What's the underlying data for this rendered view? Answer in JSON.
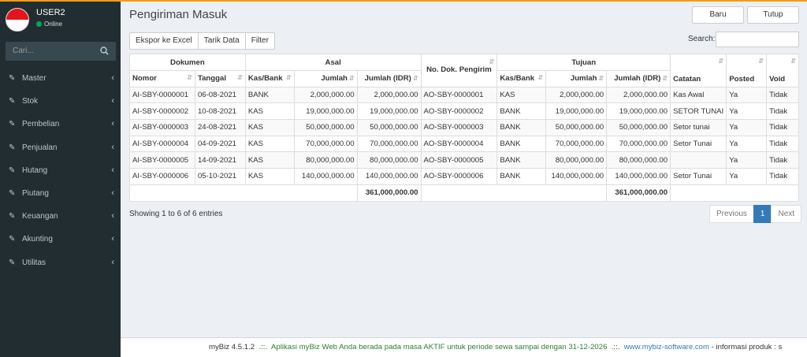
{
  "user": {
    "name": "USER2",
    "status": "Online"
  },
  "sidebar": {
    "search_placeholder": "Cari...",
    "items": [
      {
        "label": "Master"
      },
      {
        "label": "Stok"
      },
      {
        "label": "Pembelian"
      },
      {
        "label": "Penjualan"
      },
      {
        "label": "Hutang"
      },
      {
        "label": "Piutang"
      },
      {
        "label": "Keuangan"
      },
      {
        "label": "Akunting"
      },
      {
        "label": "Utilitas"
      }
    ]
  },
  "page": {
    "title": "Pengiriman Masuk",
    "new_label": "Baru",
    "close_label": "Tutup"
  },
  "toolbar": {
    "export_label": "Ekspor ke Excel",
    "fetch_label": "Tarik Data",
    "filter_label": "Filter"
  },
  "search": {
    "label": "Search:",
    "value": ""
  },
  "table": {
    "groups": {
      "dokumen": "Dokumen",
      "asal": "Asal",
      "nodok": "No. Dok. Pengirim",
      "tujuan": "Tujuan",
      "catatan": "Catatan",
      "posted": "Posted",
      "void": "Void"
    },
    "columns": [
      "Nomor",
      "Tanggal",
      "Kas/Bank",
      "Jumlah",
      "Jumlah (IDR)",
      "Kas/Bank",
      "Jumlah",
      "Jumlah (IDR)"
    ],
    "rows": [
      {
        "nomor": "AI-SBY-0000001",
        "tanggal": "06-08-2021",
        "kasbank": "BANK",
        "jumlah": "2,000,000.00",
        "jumlah_idr": "2,000,000.00",
        "nodok": "AO-SBY-0000001",
        "t_kasbank": "KAS",
        "t_jumlah": "2,000,000.00",
        "t_jumlah_idr": "2,000,000.00",
        "catatan": "Kas Awal",
        "posted": "Ya",
        "void": "Tidak"
      },
      {
        "nomor": "AI-SBY-0000002",
        "tanggal": "10-08-2021",
        "kasbank": "KAS",
        "jumlah": "19,000,000.00",
        "jumlah_idr": "19,000,000.00",
        "nodok": "AO-SBY-0000002",
        "t_kasbank": "BANK",
        "t_jumlah": "19,000,000.00",
        "t_jumlah_idr": "19,000,000.00",
        "catatan": "SETOR TUNAI",
        "posted": "Ya",
        "void": "Tidak"
      },
      {
        "nomor": "AI-SBY-0000003",
        "tanggal": "24-08-2021",
        "kasbank": "KAS",
        "jumlah": "50,000,000.00",
        "jumlah_idr": "50,000,000.00",
        "nodok": "AO-SBY-0000003",
        "t_kasbank": "BANK",
        "t_jumlah": "50,000,000.00",
        "t_jumlah_idr": "50,000,000.00",
        "catatan": "Setor tunai",
        "posted": "Ya",
        "void": "Tidak"
      },
      {
        "nomor": "AI-SBY-0000004",
        "tanggal": "04-09-2021",
        "kasbank": "KAS",
        "jumlah": "70,000,000.00",
        "jumlah_idr": "70,000,000.00",
        "nodok": "AO-SBY-0000004",
        "t_kasbank": "BANK",
        "t_jumlah": "70,000,000.00",
        "t_jumlah_idr": "70,000,000.00",
        "catatan": "Setor Tunai",
        "posted": "Ya",
        "void": "Tidak"
      },
      {
        "nomor": "AI-SBY-0000005",
        "tanggal": "14-09-2021",
        "kasbank": "KAS",
        "jumlah": "80,000,000.00",
        "jumlah_idr": "80,000,000.00",
        "nodok": "AO-SBY-0000005",
        "t_kasbank": "BANK",
        "t_jumlah": "80,000,000.00",
        "t_jumlah_idr": "80,000,000.00",
        "catatan": "",
        "posted": "Ya",
        "void": "Tidak"
      },
      {
        "nomor": "AI-SBY-0000006",
        "tanggal": "05-10-2021",
        "kasbank": "KAS",
        "jumlah": "140,000,000.00",
        "jumlah_idr": "140,000,000.00",
        "nodok": "AO-SBY-0000006",
        "t_kasbank": "BANK",
        "t_jumlah": "140,000,000.00",
        "t_jumlah_idr": "140,000,000.00",
        "catatan": "Setor Tunai",
        "posted": "Ya",
        "void": "Tidak"
      }
    ],
    "totals": {
      "asal_idr": "361,000,000.00",
      "tujuan_idr": "361,000,000.00"
    }
  },
  "pagination": {
    "info": "Showing 1 to 6 of 6 entries",
    "previous": "Previous",
    "current": "1",
    "next": "Next"
  },
  "footer": {
    "version": "myBiz 4.5.1.2",
    "sep1": ".::.",
    "message": "Aplikasi myBiz Web Anda berada pada masa AKTIF untuk periode sewa sampai dengan 31-12-2026",
    "sep2": ".::.",
    "website": "www.mybiz-software.com",
    "info": "- informasi produk : s"
  },
  "colors": {
    "sidebar": "#222d32",
    "accent": "#f39c12",
    "link": "#337ab7",
    "footer_message": "#2e7d32",
    "status": "#00a65a",
    "flag_red": "#e4141c"
  }
}
